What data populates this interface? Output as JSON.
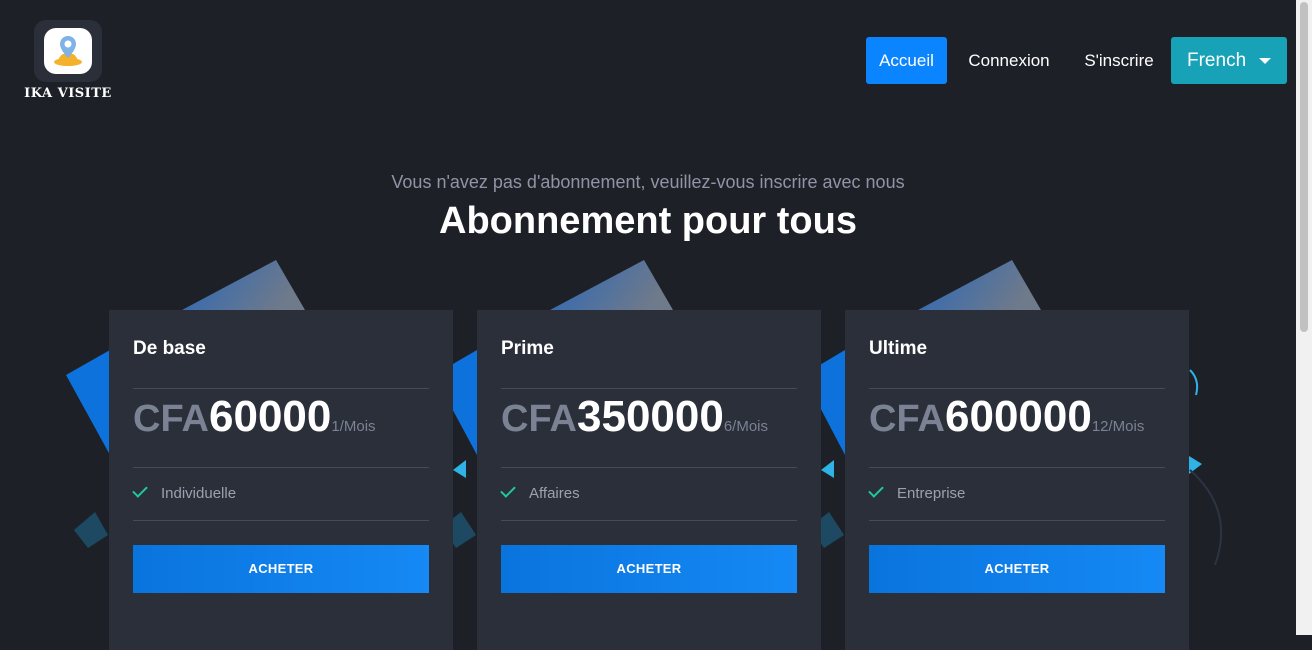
{
  "header": {
    "brand": "IKA VISITE",
    "nav": {
      "home": "Accueil",
      "login": "Connexion",
      "register": "S'inscrire"
    },
    "language": "French"
  },
  "hero": {
    "subtitle": "Vous n'avez pas d'abonnement, veuillez-vous inscrire avec nous",
    "title": "Abonnement pour tous"
  },
  "plans": [
    {
      "name": "De base",
      "currency": "CFA",
      "amount": "60000",
      "period": "1/Mois",
      "feature": "Individuelle",
      "button": "ACHETER"
    },
    {
      "name": "Prime",
      "currency": "CFA",
      "amount": "350000",
      "period": "6/Mois",
      "feature": "Affaires",
      "button": "ACHETER"
    },
    {
      "name": "Ultime",
      "currency": "CFA",
      "amount": "600000",
      "period": "12/Mois",
      "feature": "Entreprise",
      "button": "ACHETER"
    }
  ],
  "colors": {
    "background": "#1e2028",
    "card": "#2b2f3a",
    "primary": "#0b84ff",
    "language_button": "#17a2b8",
    "check": "#1fc8a0"
  }
}
